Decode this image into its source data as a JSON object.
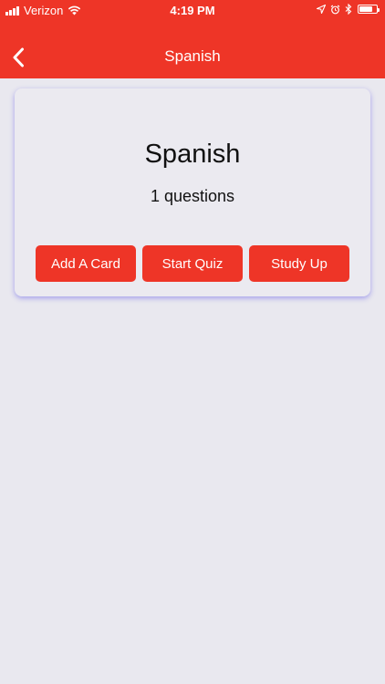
{
  "status_bar": {
    "carrier": "Verizon",
    "time": "4:19 PM",
    "battery_level": 0.75
  },
  "nav": {
    "title": "Spanish",
    "back_icon": "chevron-left-icon"
  },
  "deck": {
    "title": "Spanish",
    "count_label": "1 questions",
    "buttons": {
      "add_card": "Add A Card",
      "start_quiz": "Start Quiz",
      "study_up": "Study Up"
    }
  },
  "colors": {
    "accent": "#ee3527",
    "background": "#e9e8ef",
    "card_shadow": "#5046e6"
  }
}
